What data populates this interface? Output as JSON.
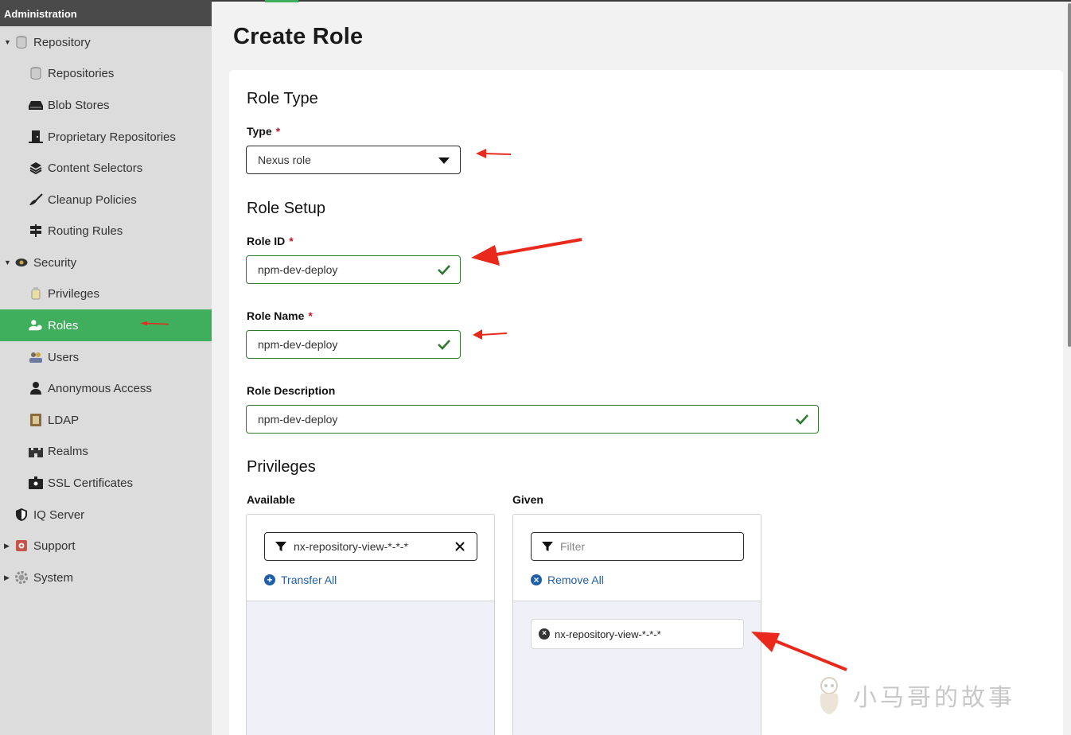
{
  "sidebar": {
    "header": "Administration",
    "items": [
      {
        "label": "Repository",
        "icon": "database-icon",
        "level": "top",
        "caret": "down"
      },
      {
        "label": "Repositories",
        "icon": "database-icon",
        "level": "child"
      },
      {
        "label": "Blob Stores",
        "icon": "hard-drive-icon",
        "level": "child"
      },
      {
        "label": "Proprietary Repositories",
        "icon": "door-icon",
        "level": "child"
      },
      {
        "label": "Content Selectors",
        "icon": "layers-icon",
        "level": "child"
      },
      {
        "label": "Cleanup Policies",
        "icon": "broom-icon",
        "level": "child"
      },
      {
        "label": "Routing Rules",
        "icon": "signpost-icon",
        "level": "child"
      },
      {
        "label": "Security",
        "icon": "eye-shield-icon",
        "level": "top",
        "caret": "down"
      },
      {
        "label": "Privileges",
        "icon": "certificate-icon",
        "level": "child"
      },
      {
        "label": "Roles",
        "icon": "user-group-icon",
        "level": "child",
        "active": true
      },
      {
        "label": "Users",
        "icon": "users-icon",
        "level": "child"
      },
      {
        "label": "Anonymous Access",
        "icon": "user-icon",
        "level": "child"
      },
      {
        "label": "LDAP",
        "icon": "book-icon",
        "level": "child"
      },
      {
        "label": "Realms",
        "icon": "castle-icon",
        "level": "child"
      },
      {
        "label": "SSL Certificates",
        "icon": "id-card-icon",
        "level": "child"
      },
      {
        "label": "IQ Server",
        "icon": "shield-icon",
        "level": "top"
      },
      {
        "label": "Support",
        "icon": "lifebuoy-icon",
        "level": "top",
        "caret": "right"
      },
      {
        "label": "System",
        "icon": "gear-icon",
        "level": "top",
        "caret": "right"
      }
    ]
  },
  "main": {
    "title": "Create Role",
    "role_type": {
      "section_title": "Role Type",
      "type_label": "Type",
      "required_mark": "*",
      "type_value": "Nexus role"
    },
    "role_setup": {
      "section_title": "Role Setup",
      "role_id_label": "Role ID",
      "role_id_value": "npm-dev-deploy",
      "role_name_label": "Role Name",
      "role_name_value": "npm-dev-deploy",
      "role_description_label": "Role Description",
      "role_description_value": "npm-dev-deploy"
    },
    "privileges": {
      "section_title": "Privileges",
      "available_label": "Available",
      "available_filter_value": "nx-repository-view-*-*-*",
      "transfer_all_label": "Transfer All",
      "given_label": "Given",
      "given_filter_placeholder": "Filter",
      "remove_all_label": "Remove All",
      "given_items": [
        "nx-repository-view-*-*-*"
      ]
    }
  },
  "watermark": "小马哥的故事",
  "colors": {
    "accent_green": "#3fae5d",
    "valid_border": "#2f7a2f",
    "required": "#c0182e",
    "link_blue": "#1f5fa8",
    "annotation_arrow": "#e8291c"
  }
}
